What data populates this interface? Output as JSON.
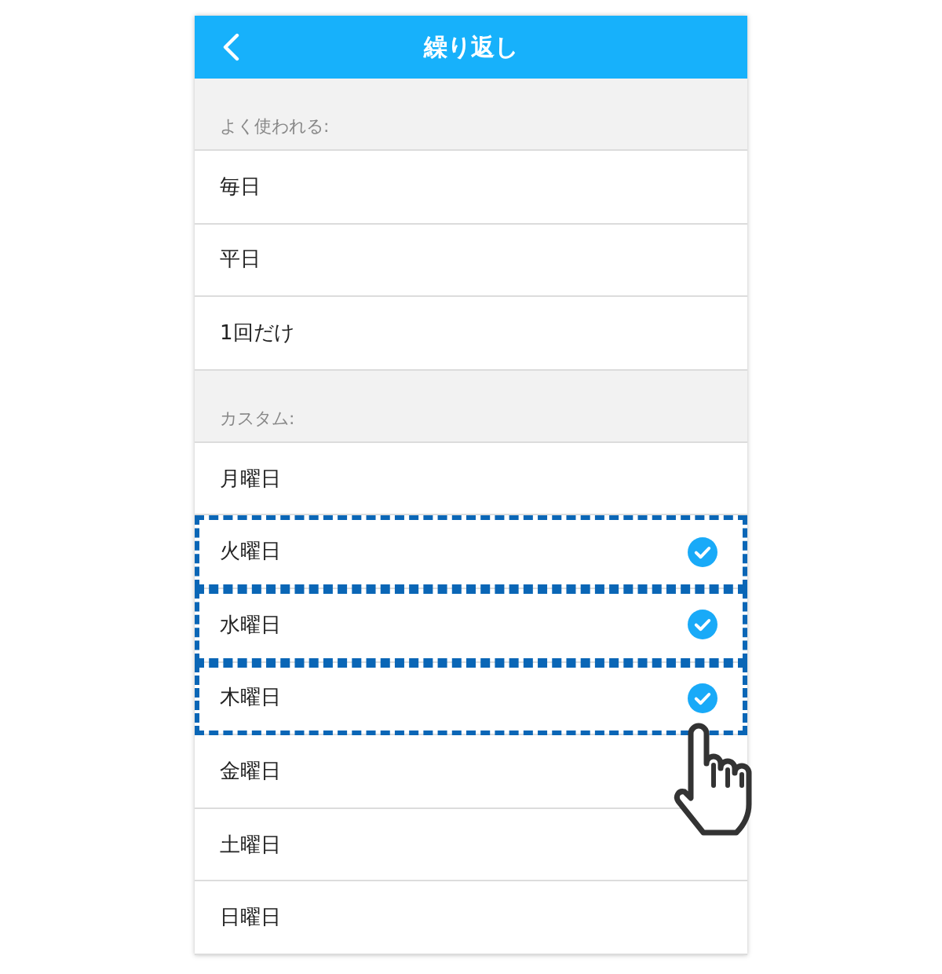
{
  "header": {
    "title": "繰り返し"
  },
  "sections": [
    {
      "label": "よく使われる:",
      "items": [
        {
          "label": "毎日",
          "checked": false,
          "highlighted": false
        },
        {
          "label": "平日",
          "checked": false,
          "highlighted": false
        },
        {
          "label": "1回だけ",
          "checked": false,
          "highlighted": false
        }
      ]
    },
    {
      "label": "カスタム:",
      "items": [
        {
          "label": "月曜日",
          "checked": false,
          "highlighted": false
        },
        {
          "label": "火曜日",
          "checked": true,
          "highlighted": true
        },
        {
          "label": "水曜日",
          "checked": true,
          "highlighted": true
        },
        {
          "label": "木曜日",
          "checked": true,
          "highlighted": true
        },
        {
          "label": "金曜日",
          "checked": false,
          "highlighted": false
        },
        {
          "label": "土曜日",
          "checked": false,
          "highlighted": false
        },
        {
          "label": "日曜日",
          "checked": false,
          "highlighted": false
        }
      ]
    }
  ]
}
